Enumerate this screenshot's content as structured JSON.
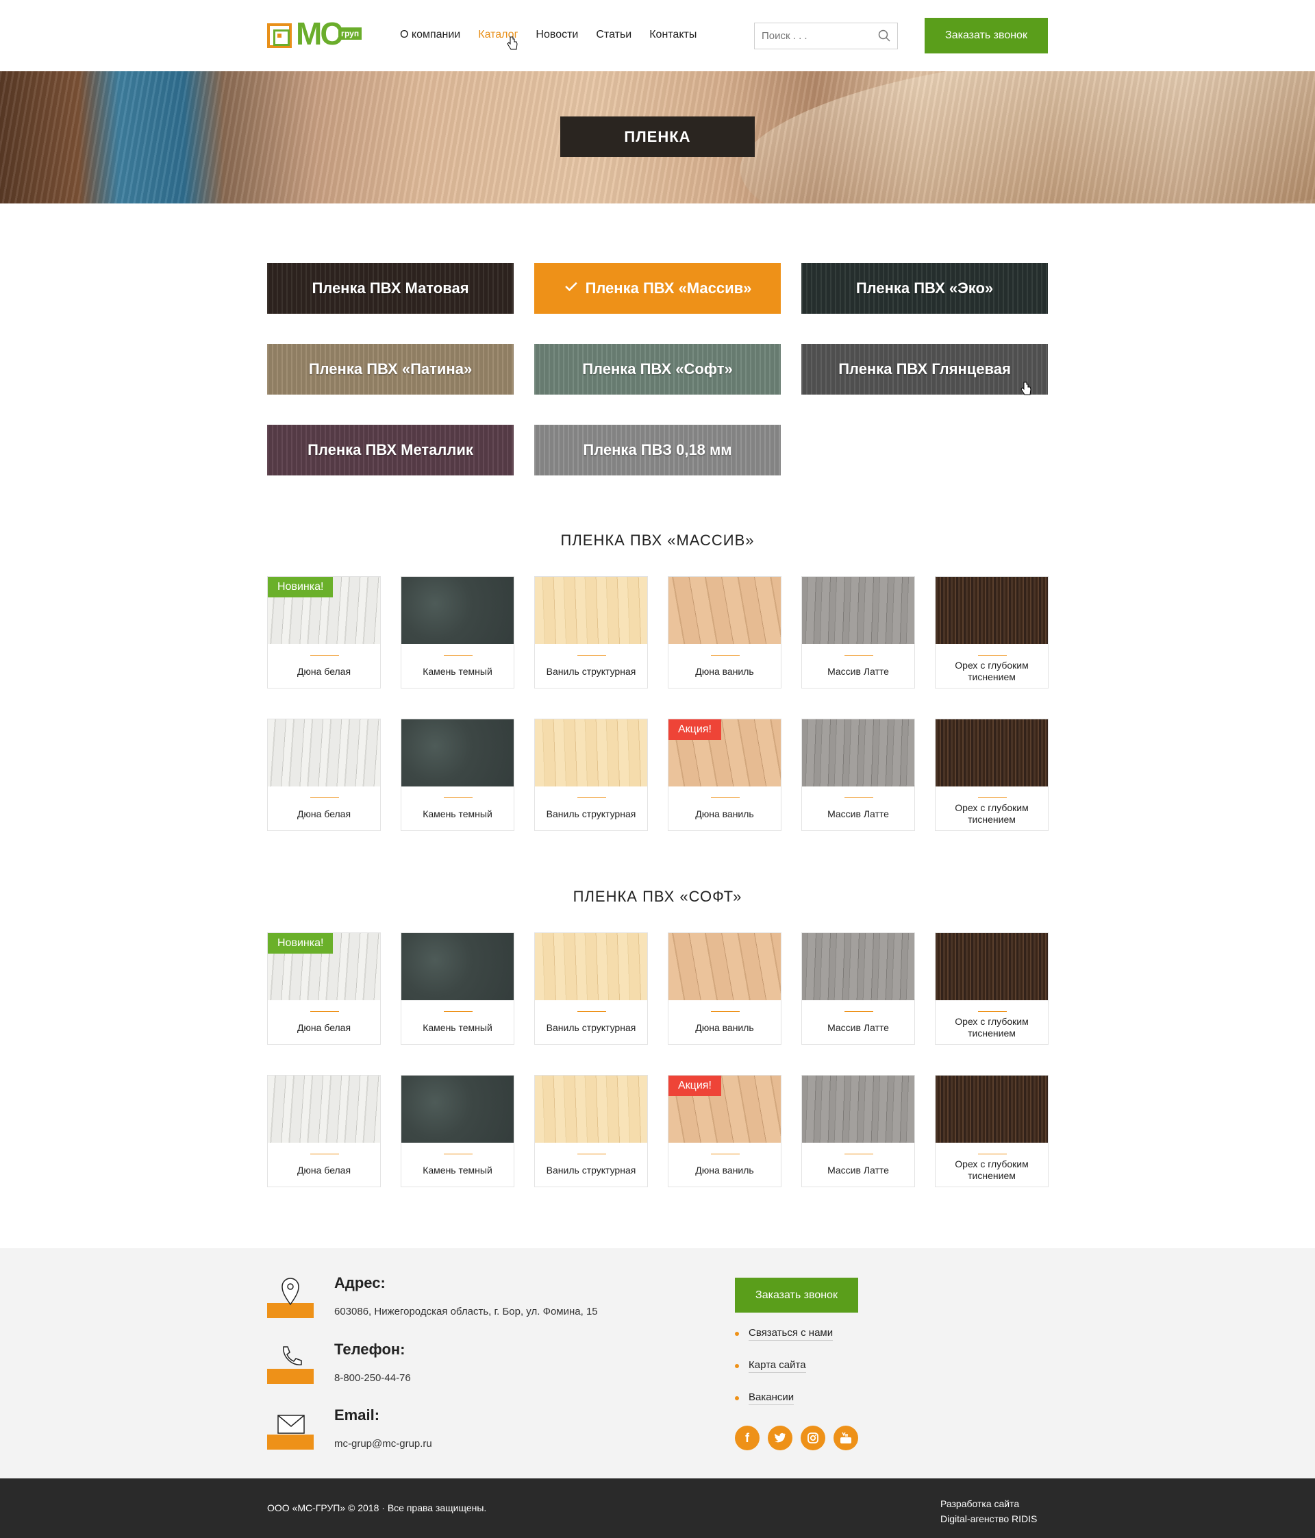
{
  "header": {
    "logo_text": "MC",
    "logo_sub": "груп",
    "nav": [
      "О компании",
      "Каталог",
      "Новости",
      "Статьи",
      "Контакты"
    ],
    "nav_active": "Каталог",
    "search_placeholder": "Поиск . . .",
    "call_button": "Заказать звонок"
  },
  "hero": {
    "title": "ПЛЕНКА"
  },
  "categories": [
    {
      "label": "Пленка ПВХ Матовая",
      "color": "#2f2520"
    },
    {
      "label": "Пленка ПВХ «Массив»",
      "color": "#ee9118",
      "selected": true
    },
    {
      "label": "Пленка ПВХ «Эко»",
      "color": "#283230"
    },
    {
      "label": "Пленка ПВХ «Патина»",
      "color": "#9a876a"
    },
    {
      "label": "Пленка ПВХ «Софт»",
      "color": "#6f8478"
    },
    {
      "label": "Пленка ПВХ Глянцевая",
      "color": "#555555"
    },
    {
      "label": "Пленка ПВХ Металлик",
      "color": "#5a3e4a"
    },
    {
      "label": "Пленка ПВЗ 0,18 мм",
      "color": "#8d8d8d"
    }
  ],
  "sections": [
    {
      "title": "ПЛЕНКА ПВХ «МАССИВ»"
    },
    {
      "title": "ПЛЕНКА ПВХ «СОФТ»"
    }
  ],
  "products": {
    "names": [
      "Дюна белая",
      "Камень темный",
      "Ваниль структурная",
      "Дюна ваниль",
      "Массив Латте",
      "Орех с глубоким тиснением"
    ],
    "badge_new": "Новинка!",
    "badge_sale": "Акция!"
  },
  "footer": {
    "address_label": "Адрес:",
    "address": "603086, Нижегородская область, г. Бор, ул. Фомина, 15",
    "phone_label": "Телефон:",
    "phone": "8-800-250-44-76",
    "email_label": "Email:",
    "email": "mc-grup@mc-grup.ru",
    "call_button": "Заказать звонок",
    "links": [
      "Связаться с нами",
      "Карта сайта",
      "Вакансии"
    ],
    "social": [
      "facebook-icon",
      "twitter-icon",
      "instagram-icon",
      "youtube-icon"
    ],
    "copyright": "ООО «МС-ГРУП» © 2018 · Все права защищены.",
    "developer_line1": "Разработка сайта",
    "developer_line2": "Digital-агенство RIDIS"
  },
  "colors": {
    "accent": "#ee9118",
    "green": "#5a9e1b",
    "new": "#6ab02a",
    "sale": "#ee4437"
  }
}
